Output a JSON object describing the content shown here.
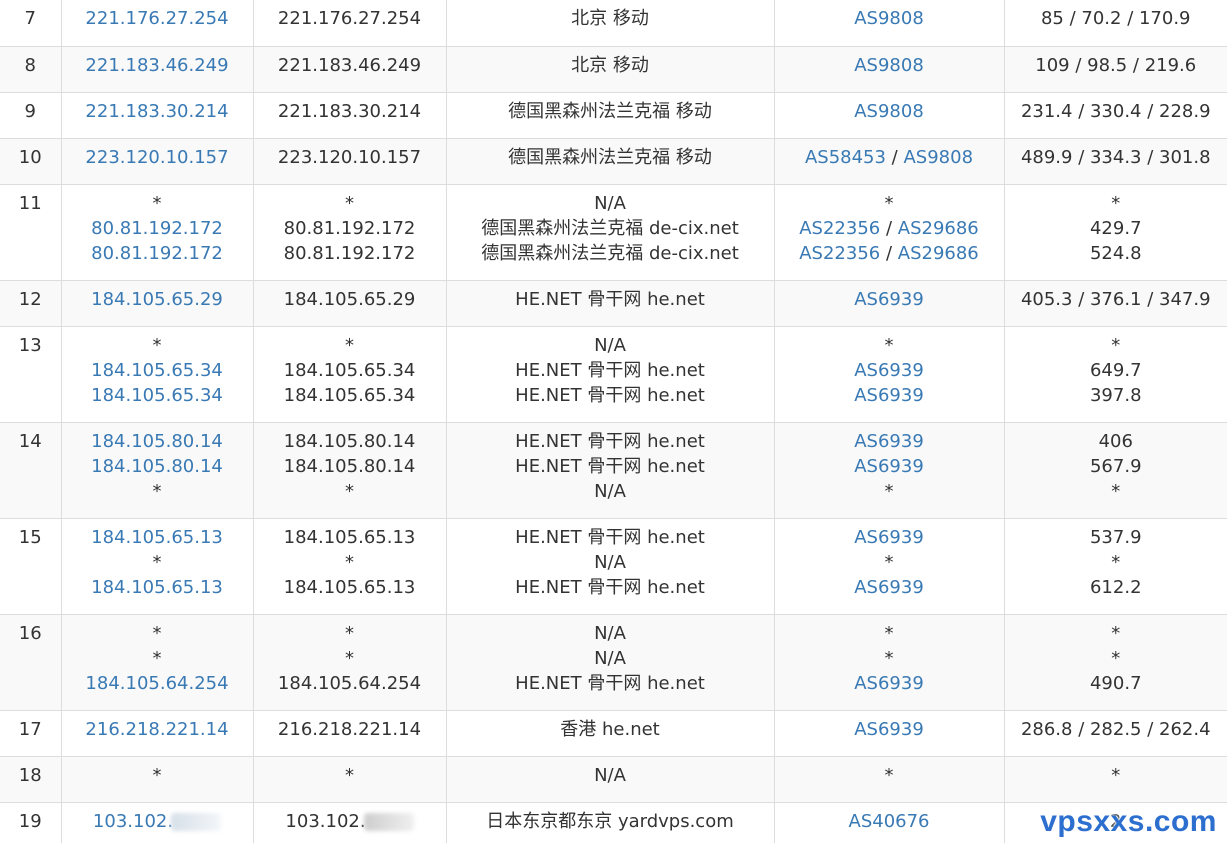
{
  "rows": [
    {
      "hop": "7",
      "ip": [
        "221.176.27.254"
      ],
      "host": [
        "221.176.27.254"
      ],
      "loc": [
        "北京 移动"
      ],
      "asn": [
        [
          "AS9808"
        ]
      ],
      "lat": [
        "85 / 70.2 / 170.9"
      ]
    },
    {
      "hop": "8",
      "ip": [
        "221.183.46.249"
      ],
      "host": [
        "221.183.46.249"
      ],
      "loc": [
        "北京 移动"
      ],
      "asn": [
        [
          "AS9808"
        ]
      ],
      "lat": [
        "109 / 98.5 / 219.6"
      ]
    },
    {
      "hop": "9",
      "ip": [
        "221.183.30.214"
      ],
      "host": [
        "221.183.30.214"
      ],
      "loc": [
        "德国黑森州法兰克福 移动"
      ],
      "asn": [
        [
          "AS9808"
        ]
      ],
      "lat": [
        "231.4 / 330.4 / 228.9"
      ]
    },
    {
      "hop": "10",
      "ip": [
        "223.120.10.157"
      ],
      "host": [
        "223.120.10.157"
      ],
      "loc": [
        "德国黑森州法兰克福 移动"
      ],
      "asn": [
        [
          "AS58453",
          "AS9808"
        ]
      ],
      "lat": [
        "489.9 / 334.3 / 301.8"
      ]
    },
    {
      "hop": "11",
      "ip": [
        "*",
        "80.81.192.172",
        "80.81.192.172"
      ],
      "host": [
        "*",
        "80.81.192.172",
        "80.81.192.172"
      ],
      "loc": [
        "N/A",
        "德国黑森州法兰克福 de-cix.net",
        "德国黑森州法兰克福 de-cix.net"
      ],
      "asn": [
        [
          "*"
        ],
        [
          "AS22356",
          "AS29686"
        ],
        [
          "AS22356",
          "AS29686"
        ]
      ],
      "lat": [
        "*",
        "429.7",
        "524.8"
      ]
    },
    {
      "hop": "12",
      "ip": [
        "184.105.65.29"
      ],
      "host": [
        "184.105.65.29"
      ],
      "loc": [
        "HE.NET 骨干网 he.net"
      ],
      "asn": [
        [
          "AS6939"
        ]
      ],
      "lat": [
        "405.3 / 376.1 / 347.9"
      ]
    },
    {
      "hop": "13",
      "ip": [
        "*",
        "184.105.65.34",
        "184.105.65.34"
      ],
      "host": [
        "*",
        "184.105.65.34",
        "184.105.65.34"
      ],
      "loc": [
        "N/A",
        "HE.NET 骨干网 he.net",
        "HE.NET 骨干网 he.net"
      ],
      "asn": [
        [
          "*"
        ],
        [
          "AS6939"
        ],
        [
          "AS6939"
        ]
      ],
      "lat": [
        "*",
        "649.7",
        "397.8"
      ]
    },
    {
      "hop": "14",
      "ip": [
        "184.105.80.14",
        "184.105.80.14",
        "*"
      ],
      "host": [
        "184.105.80.14",
        "184.105.80.14",
        "*"
      ],
      "loc": [
        "HE.NET 骨干网 he.net",
        "HE.NET 骨干网 he.net",
        "N/A"
      ],
      "asn": [
        [
          "AS6939"
        ],
        [
          "AS6939"
        ],
        [
          "*"
        ]
      ],
      "lat": [
        "406",
        "567.9",
        "*"
      ]
    },
    {
      "hop": "15",
      "ip": [
        "184.105.65.13",
        "*",
        "184.105.65.13"
      ],
      "host": [
        "184.105.65.13",
        "*",
        "184.105.65.13"
      ],
      "loc": [
        "HE.NET 骨干网 he.net",
        "N/A",
        "HE.NET 骨干网 he.net"
      ],
      "asn": [
        [
          "AS6939"
        ],
        [
          "*"
        ],
        [
          "AS6939"
        ]
      ],
      "lat": [
        "537.9",
        "*",
        "612.2"
      ]
    },
    {
      "hop": "16",
      "ip": [
        "*",
        "*",
        "184.105.64.254"
      ],
      "host": [
        "*",
        "*",
        "184.105.64.254"
      ],
      "loc": [
        "N/A",
        "N/A",
        "HE.NET 骨干网 he.net"
      ],
      "asn": [
        [
          "*"
        ],
        [
          "*"
        ],
        [
          "AS6939"
        ]
      ],
      "lat": [
        "*",
        "*",
        "490.7"
      ]
    },
    {
      "hop": "17",
      "ip": [
        "216.218.221.14"
      ],
      "host": [
        "216.218.221.14"
      ],
      "loc": [
        "香港 he.net"
      ],
      "asn": [
        [
          "AS6939"
        ]
      ],
      "lat": [
        "286.8 / 282.5 / 262.4"
      ]
    },
    {
      "hop": "18",
      "ip": [
        "*"
      ],
      "host": [
        "*"
      ],
      "loc": [
        "N/A"
      ],
      "asn": [
        [
          "*"
        ]
      ],
      "lat": [
        "*"
      ]
    },
    {
      "hop": "19",
      "ip": [
        "103.102."
      ],
      "host": [
        "103.102."
      ],
      "loc": [
        "日本东京都东京 yardvps.com"
      ],
      "asn": [
        [
          "AS40676"
        ]
      ],
      "lat": [
        "2"
      ],
      "redacted": true
    }
  ],
  "watermark": "vpsxxs.com",
  "colors": {
    "link": "#3979b4",
    "text": "#333333",
    "border": "#dddddd",
    "stripe": "#f9f9f9",
    "watermark": "#2d6fcf"
  }
}
